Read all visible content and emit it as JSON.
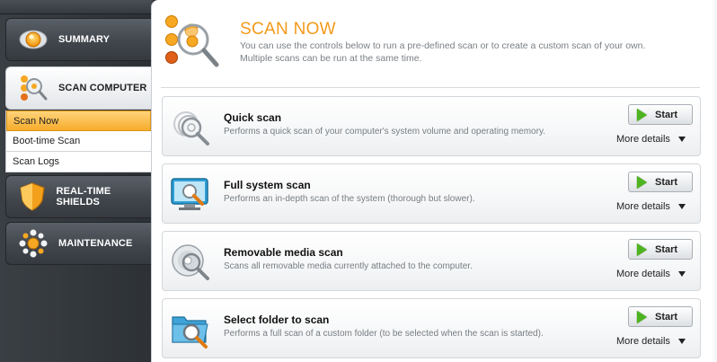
{
  "sidebar": {
    "items": [
      {
        "label": "SUMMARY",
        "icon": "summary-eye-icon"
      },
      {
        "label": "SCAN COMPUTER",
        "icon": "scan-computer-icon"
      },
      {
        "label": "REAL-TIME SHIELDS",
        "icon": "shield-icon"
      },
      {
        "label": "MAINTENANCE",
        "icon": "maintenance-icon"
      }
    ],
    "subitems": [
      {
        "label": "Scan Now"
      },
      {
        "label": "Boot-time Scan"
      },
      {
        "label": "Scan Logs"
      }
    ]
  },
  "header": {
    "title": "SCAN NOW",
    "description_line1": "You can use the controls below to run a pre-defined scan or to create a custom scan of your own.",
    "description_line2": "Multiple scans can be run at the same time."
  },
  "scans": [
    {
      "name": "Quick scan",
      "desc": "Performs a quick scan of your computer's system volume and operating memory.",
      "start": "Start",
      "more": "More details",
      "icon": "quick-scan-icon"
    },
    {
      "name": "Full system scan",
      "desc": "Performs an in-depth scan of the system (thorough but slower).",
      "start": "Start",
      "more": "More details",
      "icon": "full-system-scan-icon"
    },
    {
      "name": "Removable media scan",
      "desc": "Scans all removable media currently attached to the computer.",
      "start": "Start",
      "more": "More details",
      "icon": "removable-media-icon"
    },
    {
      "name": "Select folder to scan",
      "desc": "Performs a full scan of a custom folder (to be selected when the scan is started).",
      "start": "Start",
      "more": "More details",
      "icon": "folder-scan-icon"
    }
  ],
  "colors": {
    "accent_orange": "#f39a1b",
    "start_green": "#4db31f",
    "sidebar_dark": "#2d3135"
  }
}
